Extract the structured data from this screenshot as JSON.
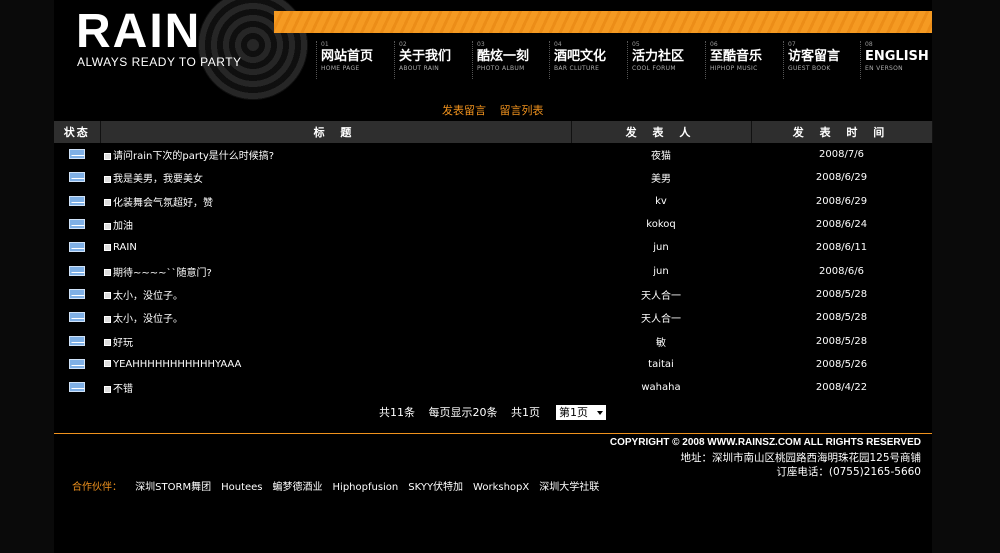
{
  "brand": {
    "logo": "RAIN",
    "tagline": "ALWAYS READY TO PARTY",
    "accent": "#f59a22"
  },
  "nav": [
    {
      "num": "01",
      "cn": "网站首页",
      "en": "HOME PAGE"
    },
    {
      "num": "02",
      "cn": "关于我们",
      "en": "ABOUT RAIN"
    },
    {
      "num": "03",
      "cn": "酷炫一刻",
      "en": "PHOTO ALBUM"
    },
    {
      "num": "04",
      "cn": "酒吧文化",
      "en": "BAR CLUTURE"
    },
    {
      "num": "05",
      "cn": "活力社区",
      "en": "COOL FORUM"
    },
    {
      "num": "06",
      "cn": "至酷音乐",
      "en": "HIPHOP MUSIC"
    },
    {
      "num": "07",
      "cn": "访客留言",
      "en": "GUEST BOOK"
    },
    {
      "num": "08",
      "cn": "ENGLISH",
      "en": "EN VERSON"
    }
  ],
  "sublinks": {
    "post": "发表留言",
    "list": "留言列表"
  },
  "table": {
    "headers": {
      "status": "状态",
      "title": "标    题",
      "author": "发 表 人",
      "time": "发 表 时 间"
    },
    "rows": [
      {
        "title": "请问rain下次的party是什么时候搞?",
        "author": "夜猫",
        "date": "2008/7/6"
      },
      {
        "title": "我是美男，我要美女",
        "author": "美男",
        "date": "2008/6/29"
      },
      {
        "title": "化装舞会气氛超好，赞",
        "author": "kv",
        "date": "2008/6/29"
      },
      {
        "title": "加油",
        "author": "kokoq",
        "date": "2008/6/24"
      },
      {
        "title": "RAIN",
        "author": "jun",
        "date": "2008/6/11"
      },
      {
        "title": "期待~~~~``随意门?",
        "author": "jun",
        "date": "2008/6/6"
      },
      {
        "title": "太小，没位子。",
        "author": "天人合一",
        "date": "2008/5/28"
      },
      {
        "title": "太小，没位子。",
        "author": "天人合一",
        "date": "2008/5/28"
      },
      {
        "title": "好玩",
        "author": "敏",
        "date": "2008/5/28"
      },
      {
        "title": "YEAHHHHHHHHHHHYAAA",
        "author": "taitai",
        "date": "2008/5/26"
      },
      {
        "title": "不错",
        "author": "wahaha",
        "date": "2008/4/22"
      }
    ]
  },
  "pager": {
    "total": "共11条",
    "per_page": "每页显示20条",
    "pages": "共1页",
    "selected": "第1页"
  },
  "footer": {
    "copyright": "COPYRIGHT © 2008 WWW.RAINSZ.COM ALL RIGHTS RESERVED",
    "address": "地址：深圳市南山区桃园路西海明珠花园125号商铺",
    "phone": "订座电话：(0755)2165-5660",
    "partners_label": "合作伙伴：",
    "partners": [
      "深圳STORM舞团",
      "Houtees",
      "蝙梦德酒业",
      "Hiphopfusion",
      "SKYY伏特加",
      "WorkshopX",
      "深圳大学社联"
    ]
  }
}
